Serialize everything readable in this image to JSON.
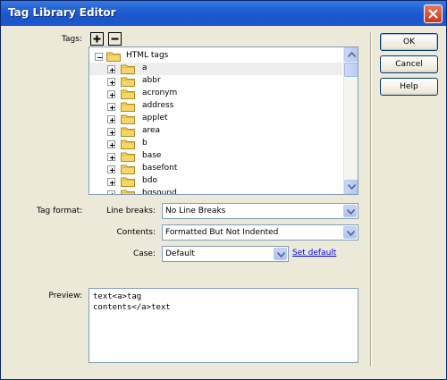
{
  "window": {
    "title": "Tag Library Editor"
  },
  "tags": {
    "label": "Tags:",
    "root": "HTML tags",
    "items": [
      "a",
      "abbr",
      "acronym",
      "address",
      "applet",
      "area",
      "b",
      "base",
      "basefont",
      "bdo",
      "bgsound"
    ]
  },
  "format": {
    "label": "Tag format:",
    "line_breaks_label": "Line breaks:",
    "line_breaks_value": "No Line Breaks",
    "contents_label": "Contents:",
    "contents_value": "Formatted But Not Indented",
    "case_label": "Case:",
    "case_value": "Default",
    "set_default": "Set default"
  },
  "preview": {
    "label": "Preview:",
    "text": "text<a>tag\ncontents</a>text"
  },
  "buttons": {
    "ok": "OK",
    "cancel": "Cancel",
    "help": "Help"
  },
  "colors": {
    "titlebar": "#1f5ed4",
    "dialog_bg": "#ece9d8",
    "link": "#0000ee"
  }
}
